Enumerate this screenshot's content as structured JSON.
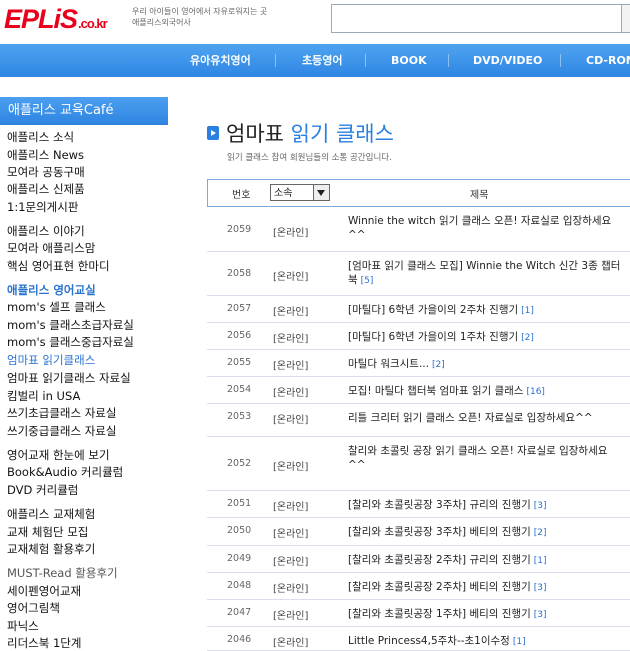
{
  "header": {
    "logo_text": "EPLiS",
    "logo_domain": ".co.kr",
    "tagline_line1": "우리 아이들이 영어에서 자유로워지는 곳",
    "tagline_line2": "애플리스외국어사"
  },
  "nav": {
    "items": [
      "유아유치영어",
      "초등영어",
      "BOOK",
      "DVD/VIDEO",
      "CD-ROM"
    ]
  },
  "sidebar": {
    "title": "애플리스 교육Café",
    "items": [
      "애플리스 소식",
      "애플리스 News",
      "모여라 공동구매",
      "애플리스 신제품",
      "1:1문의게시판",
      "애플리스 이야기",
      "모여라 애플리스맘",
      "핵심 영어표현 한마디",
      "애플리스 영어교실",
      "mom's 셀프 클래스",
      "mom's 클래스초급자료실",
      "mom's 클래스중급자료실",
      "엄마표 읽기클래스",
      "엄마표 읽기클래스 자료실",
      "킴벌리 in USA",
      "쓰기초급클래스 자료실",
      "쓰기중급클래스 자료실",
      "영어교재 한눈에 보기",
      "Book&Audio 커리큘럼",
      "DVD 커리큘럼",
      "애플리스 교재체험",
      "교재 체험단 모집",
      "교재체험 활용후기",
      "MUST-Read 활용후기",
      "세이펜영어교재",
      "영어그림책",
      "파닉스",
      "리더스북 1단계"
    ]
  },
  "main": {
    "title_part1": "엄마표",
    "title_part2": "읽기 클래스",
    "subtitle": "읽기 클래스 참여 회원님들의 소통 공간입니다.",
    "table_header": {
      "num": "번호",
      "select": "소속",
      "title": "제목"
    },
    "rows": [
      {
        "num": "2059",
        "cat": "[온라인]",
        "title": "Winnie the witch 읽기 클래스 오픈! 자료실로 입장하세요^^",
        "count": ""
      },
      {
        "num": "2058",
        "cat": "[온라인]",
        "title": "[엄마표 읽기 클래스 모집] Winnie the Witch 신간 3종 챕터북",
        "count": "[5]"
      },
      {
        "num": "2057",
        "cat": "[온라인]",
        "title": "[마틸다] 6학년 가을이의 2주차 진행기",
        "count": "[1]"
      },
      {
        "num": "2056",
        "cat": "[온라인]",
        "title": "[마틸다] 6학년 가을이의 1주차 진행기",
        "count": "[2]"
      },
      {
        "num": "2055",
        "cat": "[온라인]",
        "title": "마틸다 워크시트...",
        "count": "[2]"
      },
      {
        "num": "2054",
        "cat": "[온라인]",
        "title": "모집! 마틸다 챕터북 엄마표 읽기 클래스",
        "count": "[16]"
      },
      {
        "num": "2053",
        "cat": "[온라인]",
        "title": "리틀 크리터 읽기 클래스 오픈! 자료실로 입장하세요^^",
        "count": ""
      },
      {
        "num": "2052",
        "cat": "[온라인]",
        "title": "찰리와 초콜릿 공장 읽기 클래스 오픈! 자료실로 입장하세요^^",
        "count": ""
      },
      {
        "num": "2051",
        "cat": "[온라인]",
        "title": "[찰리와 초콜릿공장 3주차] 규리의 진행기",
        "count": "[3]"
      },
      {
        "num": "2050",
        "cat": "[온라인]",
        "title": "[찰리와 초콜릿공장 3주차] 베티의 진행기",
        "count": "[2]"
      },
      {
        "num": "2049",
        "cat": "[온라인]",
        "title": "[찰리와 초콜릿공장 2주차] 규리의 진행기",
        "count": "[1]"
      },
      {
        "num": "2048",
        "cat": "[온라인]",
        "title": "[찰리와 초콜릿공장 2주차] 베티의 진행기",
        "count": "[3]"
      },
      {
        "num": "2047",
        "cat": "[온라인]",
        "title": "[찰리와 초콜릿공장 1주차] 베티의 진행기",
        "count": "[3]"
      },
      {
        "num": "2046",
        "cat": "[온라인]",
        "title": "Little Princess4,5주차--초1이수정",
        "count": "[1]"
      }
    ]
  },
  "colors": {
    "brand_red": "#e8001c",
    "nav_blue": "#3a90e8",
    "link_blue": "#2a74d0"
  }
}
